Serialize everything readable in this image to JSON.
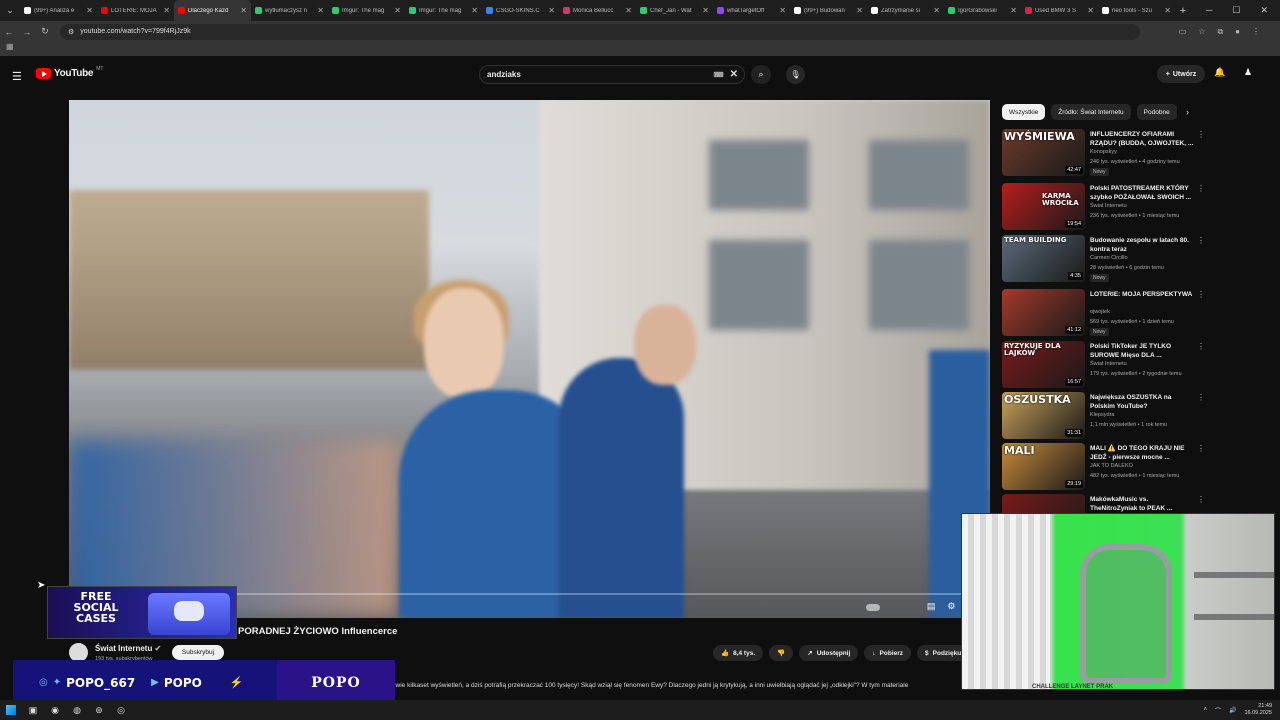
{
  "browser": {
    "tabs": [
      {
        "title": "(99+) Analiza e",
        "color": "#ffffff",
        "active": false
      },
      {
        "title": "LOTERIE: MOJA",
        "color": "#ff0000",
        "active": false
      },
      {
        "title": "Dlaczego Każd",
        "color": "#ff0000",
        "active": true
      },
      {
        "title": "wytłumaczysz n",
        "color": "#2ecc71",
        "active": false
      },
      {
        "title": "Imgur: The mag",
        "color": "#2ecc71",
        "active": false
      },
      {
        "title": "Imgur: The mag",
        "color": "#2ecc71",
        "active": false
      },
      {
        "title": "CSGO-SKINS.C",
        "color": "#3b82f6",
        "active": false
      },
      {
        "title": "Monica Bellucc",
        "color": "#e1306c",
        "active": false
      },
      {
        "title": "Chef_Jan - Wat",
        "color": "#2ecc71",
        "active": false
      },
      {
        "title": "whatTargetOff",
        "color": "#9146ff",
        "active": false
      },
      {
        "title": "(99+) Budowan",
        "color": "#ffffff",
        "active": false
      },
      {
        "title": "Zatrzymanie si",
        "color": "#ffffff",
        "active": false
      },
      {
        "title": "IgorGrabowski",
        "color": "#2ecc71",
        "active": false
      },
      {
        "title": "Used BMW 3 S",
        "color": "#e11d48",
        "active": false
      },
      {
        "title": "neo tools - Szu",
        "color": "#ffffff",
        "active": false
      }
    ],
    "url": "youtube.com/watch?v=799f4RjJz9k"
  },
  "header": {
    "logo_text": "YouTube",
    "logo_region": "MT",
    "search_value": "andziaks",
    "create_label": "Utwórz"
  },
  "promo": {
    "line1": "FREE",
    "line2": "SOCIAL",
    "line3": "CASES"
  },
  "video": {
    "title": "PORADNEJ ŻYCIOWO Influencerce",
    "channel": "Świat Internetu",
    "subs": "193 tys. subskrybentów",
    "subscribe_label": "Subskrybuj",
    "likes": "8,4 tys.",
    "share_label": "Udostępnij",
    "download_label": "Pobierz",
    "thanks_label": "Podziękuj",
    "description": "zaledwie kilkaset wyświetleń, a dziś potrafią przekraczać 100 tysięcy! Skąd wziął się fenomen Ewy? Dlaczego jedni ją krytykują, a inni uwielbiają oglądać jej „odklejki\"? W tym materiale"
  },
  "social": {
    "handle1": "POPO_667",
    "handle2": "POPO",
    "brand": "POPO"
  },
  "sidebar": {
    "chips": [
      "Wszystkie",
      "Źródło: Świat Internetu",
      "Podobne"
    ],
    "items": [
      {
        "title": "INFLUENCERZY OFIARAMI RZĄDU? (BUDDA, OJWOJTEK, ...",
        "channel": "Konopskyy",
        "meta": "246 tys. wyświetleń • 4 godziny temu",
        "badge": "Nowy",
        "duration": "42:47",
        "thumb_text": "WYŚMIEWA",
        "thumb_color": "#6b3a2a"
      },
      {
        "title": "Polski PATOSTREAMER KTÓRY szybko POŻAŁOWAŁ SWOICH ...",
        "channel": "Świat Internetu",
        "meta": "236 tys. wyświetleń • 1 miesiąc temu",
        "badge": "",
        "duration": "19:54",
        "thumb_text": "KARMA WRÓCIŁA",
        "thumb_color": "#b91c1c"
      },
      {
        "title": "Budowanie zespołu w latach 80. kontra teraz",
        "channel": "Carmen Circillo",
        "meta": "28 wyświetleń • 6 godzin temu",
        "badge": "Nowy",
        "duration": "4:35",
        "thumb_text": "TEAM BUILDING",
        "thumb_color": "#5b6b7a"
      },
      {
        "title": "LOTERIE: MOJA PERSPEKTYWA",
        "channel": "ojwojtek",
        "meta": "569 tys. wyświetleń • 1 dzień temu",
        "badge": "Nowy",
        "duration": "41:12",
        "thumb_text": "",
        "thumb_color": "#a33a2a"
      },
      {
        "title": "Polski TikToker JE TYLKO SUROWE Mięso DLA ...",
        "channel": "Świat Internetu",
        "meta": "179 tys. wyświetleń • 2 tygodnie temu",
        "badge": "",
        "duration": "16:57",
        "thumb_text": "RYZYKUJE DLA LAJKÓW",
        "thumb_color": "#7a1a1a"
      },
      {
        "title": "Największa OSZUSTKA na Polskim YouTube?",
        "channel": "Klepsydra",
        "meta": "1,1 mln wyświetleń • 1 rok temu",
        "badge": "",
        "duration": "31:31",
        "thumb_text": "OSZUSTKA",
        "thumb_color": "#c9a25a"
      },
      {
        "title": "MALI ⚠️ DO TEGO KRAJU NIE JEDŹ - pierwsze mocne ...",
        "channel": "JAK TO DALEKO",
        "meta": "482 tys. wyświetleń • 1 miesiąc temu",
        "badge": "",
        "duration": "29:19",
        "thumb_text": "MALI",
        "thumb_color": "#c98a3a"
      },
      {
        "title": "MakówkaMusic vs. TheNitroZyniak to PEAK ...",
        "channel": "",
        "meta": "",
        "badge": "",
        "duration": "",
        "thumb_text": "",
        "thumb_color": "#7a1a1a"
      }
    ]
  },
  "webcam": {
    "caption": "CHALLENGE LAYNET PRAK"
  },
  "taskbar": {
    "time": "21:49",
    "date": "16.09.2025"
  }
}
